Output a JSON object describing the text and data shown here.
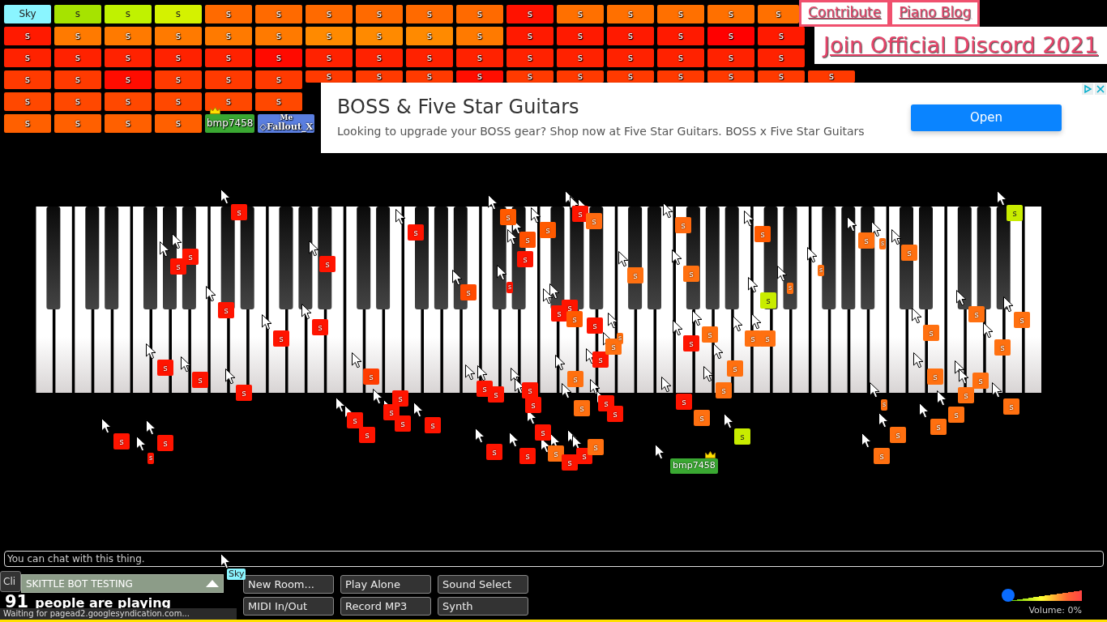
{
  "players": [
    [
      {
        "label": "Sky",
        "color": "#8af5ff",
        "owner": false
      },
      {
        "label": "s",
        "color": "#a6e300",
        "owner": false
      },
      {
        "label": "s",
        "color": "#c0f200",
        "owner": false
      },
      {
        "label": "s",
        "color": "#d4f200",
        "owner": false
      },
      {
        "label": "s",
        "color": "#ff6a00",
        "owner": false
      },
      {
        "label": "s",
        "color": "#ff6a00",
        "owner": false
      },
      {
        "label": "s",
        "color": "#ff6a00",
        "owner": false
      },
      {
        "label": "s",
        "color": "#ff6a00",
        "owner": false
      },
      {
        "label": "s",
        "color": "#ff6a00",
        "owner": false
      },
      {
        "label": "s",
        "color": "#ff6a00",
        "owner": false
      },
      {
        "label": "s",
        "color": "#ff1200",
        "owner": false
      },
      {
        "label": "s",
        "color": "#ff7000",
        "owner": false
      },
      {
        "label": "s",
        "color": "#ff7000",
        "owner": false
      },
      {
        "label": "s",
        "color": "#ff7000",
        "owner": false
      },
      {
        "label": "s",
        "color": "#ff7000",
        "owner": false
      },
      {
        "label": "s",
        "color": "#ff7000",
        "owner": false
      }
    ],
    [
      {
        "label": "s",
        "color": "#ff1a00",
        "owner": false
      },
      {
        "label": "s",
        "color": "#ff7a00",
        "owner": false
      },
      {
        "label": "s",
        "color": "#ff7a00",
        "owner": false
      },
      {
        "label": "s",
        "color": "#ff7a00",
        "owner": false
      },
      {
        "label": "s",
        "color": "#ff7a00",
        "owner": false
      },
      {
        "label": "s",
        "color": "#ff7a00",
        "owner": false
      },
      {
        "label": "s",
        "color": "#ff8a00",
        "owner": false
      },
      {
        "label": "s",
        "color": "#ff8a00",
        "owner": false
      },
      {
        "label": "s",
        "color": "#ff8a00",
        "owner": false
      },
      {
        "label": "s",
        "color": "#ff7a00",
        "owner": false
      },
      {
        "label": "s",
        "color": "#ff1a00",
        "owner": false
      },
      {
        "label": "s",
        "color": "#ff1a00",
        "owner": false
      },
      {
        "label": "s",
        "color": "#ff1a00",
        "owner": false
      },
      {
        "label": "s",
        "color": "#ff1a00",
        "owner": false
      },
      {
        "label": "s",
        "color": "#ff0000",
        "owner": false
      },
      {
        "label": "s",
        "color": "#ff1a00",
        "owner": false
      }
    ],
    [
      {
        "label": "s",
        "color": "#ff2200",
        "owner": false
      },
      {
        "label": "s",
        "color": "#ff2200",
        "owner": false
      },
      {
        "label": "s",
        "color": "#ff2200",
        "owner": false
      },
      {
        "label": "s",
        "color": "#ff2200",
        "owner": false
      },
      {
        "label": "s",
        "color": "#ff2200",
        "owner": false
      },
      {
        "label": "s",
        "color": "#ff0a00",
        "owner": false
      },
      {
        "label": "s",
        "color": "#ff2200",
        "owner": false
      },
      {
        "label": "s",
        "color": "#ff2200",
        "owner": false
      },
      {
        "label": "s",
        "color": "#ff2200",
        "owner": false
      },
      {
        "label": "s",
        "color": "#ff2200",
        "owner": false
      },
      {
        "label": "s",
        "color": "#ff2200",
        "owner": false
      },
      {
        "label": "s",
        "color": "#ff2200",
        "owner": false
      },
      {
        "label": "s",
        "color": "#ff2200",
        "owner": false
      },
      {
        "label": "s",
        "color": "#ff2200",
        "owner": false
      },
      {
        "label": "s",
        "color": "#ff2200",
        "owner": false
      },
      {
        "label": "s",
        "color": "#ff2200",
        "owner": false
      }
    ],
    [
      {
        "label": "s",
        "color": "#ff3a00",
        "owner": false
      },
      {
        "label": "s",
        "color": "#ff3a00",
        "owner": false
      },
      {
        "label": "s",
        "color": "#ff0c00",
        "owner": false
      },
      {
        "label": "s",
        "color": "#ff3a00",
        "owner": false
      },
      {
        "label": "s",
        "color": "#ff3a00",
        "owner": false
      },
      {
        "label": "s",
        "color": "#ff3a00",
        "owner": false
      },
      {
        "label": "s",
        "color": "#ff3a00",
        "owner": false
      },
      {
        "label": "s",
        "color": "#ff3a00",
        "owner": false
      },
      {
        "label": "s",
        "color": "#ff3a00",
        "owner": false
      },
      {
        "label": "s",
        "color": "#ff0e00",
        "owner": false
      },
      {
        "label": "s",
        "color": "#ff3a00",
        "owner": false
      },
      {
        "label": "s",
        "color": "#ff3a00",
        "owner": false
      },
      {
        "label": "s",
        "color": "#ff3a00",
        "owner": false
      },
      {
        "label": "s",
        "color": "#ff3a00",
        "owner": false
      },
      {
        "label": "s",
        "color": "#ff3a00",
        "owner": false
      },
      {
        "label": "s",
        "color": "#ff3a00",
        "owner": false
      },
      {
        "label": "s",
        "color": "#ff3a00",
        "owner": false
      }
    ],
    [
      {
        "label": "s",
        "color": "#ff4800",
        "owner": false
      },
      {
        "label": "s",
        "color": "#ff4800",
        "owner": false
      },
      {
        "label": "s",
        "color": "#ff4800",
        "owner": false
      },
      {
        "label": "s",
        "color": "#ff4800",
        "owner": false
      },
      {
        "label": "s",
        "color": "#ff4800",
        "owner": false
      },
      {
        "label": "s",
        "color": "#ff4800",
        "owner": false
      }
    ],
    [
      {
        "label": "s",
        "color": "#ff6000",
        "owner": false
      },
      {
        "label": "s",
        "color": "#ff6000",
        "owner": false
      },
      {
        "label": "s",
        "color": "#ff6000",
        "owner": false
      },
      {
        "label": "s",
        "color": "#ff6000",
        "owner": false
      },
      {
        "label": "bmp7458",
        "color": "#3aa832",
        "owner": true
      },
      {
        "label": "◇Fallout_X",
        "color": "#5a7ee0",
        "owner": false,
        "note": "Me"
      }
    ]
  ],
  "links": [
    {
      "label": "Contribute"
    },
    {
      "label": "Piano Blog"
    }
  ],
  "discord": "Join Official Discord 2021",
  "ad": {
    "headline": "BOSS & Five Star Guitars",
    "text": "Looking to upgrade your BOSS gear? Shop now at Five Star Guitars. BOSS x Five Star Guitars",
    "button": "Open"
  },
  "cursors": [
    {
      "label": "s",
      "color": "#ff1400",
      "owner": false
    },
    {
      "label": "s",
      "color": "#ff1400",
      "owner": false
    },
    {
      "label": "s",
      "color": "#ff1400",
      "owner": false
    },
    {
      "label": "s",
      "color": "#ff1400",
      "owner": false
    },
    {
      "label": "s",
      "color": "#ff1400",
      "owner": false
    },
    {
      "label": "s",
      "color": "#ff1400",
      "owner": false
    },
    {
      "label": "s",
      "color": "#ff1400",
      "owner": false
    },
    {
      "label": "s",
      "color": "#ff1400",
      "owner": false
    },
    {
      "label": "s",
      "color": "#ff1400",
      "owner": false
    },
    {
      "label": "s",
      "color": "#ff1400",
      "owner": false
    },
    {
      "label": "s",
      "color": "#ff1400",
      "owner": false
    },
    {
      "label": "s",
      "color": "#ff1400",
      "owner": false
    },
    {
      "label": "s",
      "color": "#ff1400",
      "owner": false
    },
    {
      "label": "s",
      "color": "#ff1400",
      "owner": false
    },
    {
      "label": "s",
      "color": "#ff4a00",
      "owner": false
    },
    {
      "label": "s",
      "color": "#ff5a00",
      "owner": false
    },
    {
      "label": "s",
      "color": "#ff5000",
      "owner": false
    },
    {
      "label": "s",
      "color": "#ff1400",
      "owner": false
    },
    {
      "label": "s",
      "color": "#ff5a00",
      "owner": false
    },
    {
      "label": "s",
      "color": "#ff1400",
      "owner": false
    },
    {
      "label": "s",
      "color": "#ff1400",
      "owner": false
    },
    {
      "label": "s",
      "color": "#ff6a10",
      "owner": false
    },
    {
      "label": "s",
      "color": "#ff6a10",
      "owner": false
    },
    {
      "label": "s",
      "color": "#ff5a00",
      "owner": false
    },
    {
      "label": "s",
      "color": "#ff7010",
      "owner": false
    },
    {
      "label": "s",
      "color": "#ff7010",
      "owner": false
    },
    {
      "label": "s",
      "color": "#ff7010",
      "owner": false
    },
    {
      "label": "s",
      "color": "#ff7010",
      "owner": false
    },
    {
      "label": "s",
      "color": "#ff7010",
      "owner": false
    },
    {
      "label": "s",
      "color": "#ff7010",
      "owner": false
    },
    {
      "label": "s",
      "color": "#ff7010",
      "owner": false
    },
    {
      "label": "s",
      "color": "#c8ec00",
      "owner": false
    },
    {
      "label": "s",
      "color": "#c8ec00",
      "owner": false
    },
    {
      "label": "s",
      "color": "#ff1400",
      "owner": false
    },
    {
      "label": "s",
      "color": "#ff1400",
      "owner": false
    },
    {
      "label": "s",
      "color": "#ff5a00",
      "owner": false
    },
    {
      "label": "s",
      "color": "#ff1400",
      "owner": false
    },
    {
      "label": "s",
      "color": "#ff1400",
      "owner": false
    },
    {
      "label": "s",
      "color": "#ff7010",
      "owner": false
    },
    {
      "label": "s",
      "color": "#ff7010",
      "owner": false
    },
    {
      "label": "s",
      "color": "#ff7010",
      "owner": false
    },
    {
      "label": "s",
      "color": "#ff1400",
      "owner": false
    },
    {
      "label": "s",
      "color": "#ff7010",
      "owner": false
    },
    {
      "label": "s",
      "color": "#ff7010",
      "owner": false
    },
    {
      "label": "s",
      "color": "#ff7010",
      "owner": false
    },
    {
      "label": "s",
      "color": "#ff7010",
      "owner": false
    },
    {
      "label": "s",
      "color": "#ff7010",
      "owner": false
    },
    {
      "label": "s",
      "color": "#ff7010",
      "owner": false
    },
    {
      "label": "s",
      "color": "#ff7010",
      "owner": false
    },
    {
      "label": "s",
      "color": "#ff7010",
      "owner": false
    },
    {
      "label": "s",
      "color": "#ff7010",
      "owner": false
    },
    {
      "label": "s",
      "color": "#ff7010",
      "owner": false
    },
    {
      "label": "s",
      "color": "#ff7010",
      "owner": false
    },
    {
      "label": "s",
      "color": "#ff7010",
      "owner": false
    },
    {
      "label": "s",
      "color": "#ff7010",
      "owner": false
    },
    {
      "label": "s",
      "color": "#ff7010",
      "owner": false
    },
    {
      "label": "s",
      "color": "#ff7010",
      "owner": false
    },
    {
      "label": "s",
      "color": "#ff7010",
      "owner": false
    },
    {
      "label": "s",
      "color": "#ff7010",
      "owner": false
    },
    {
      "label": "s",
      "color": "#ff3c00",
      "owner": false
    },
    {
      "label": "s",
      "color": "#ff1400",
      "owner": false
    },
    {
      "label": "s",
      "color": "#ff1400",
      "owner": false
    },
    {
      "label": "s",
      "color": "#ff1400",
      "owner": false
    },
    {
      "label": "s",
      "color": "#ff1400",
      "owner": false
    },
    {
      "label": "s",
      "color": "#ff1400",
      "owner": false
    },
    {
      "label": "s",
      "color": "#ff1400",
      "owner": false
    },
    {
      "label": "s",
      "color": "#ff1400",
      "owner": false
    },
    {
      "label": "s",
      "color": "#ff1400",
      "owner": false
    },
    {
      "label": "s",
      "color": "#ff1400",
      "owner": false
    },
    {
      "label": "s",
      "color": "#ff1400",
      "owner": false
    },
    {
      "label": "s",
      "color": "#ff7010",
      "owner": false
    },
    {
      "label": "s",
      "color": "#ff7010",
      "owner": false
    },
    {
      "label": "s",
      "color": "#ff1400",
      "owner": false
    },
    {
      "label": "s",
      "color": "#ff1400",
      "owner": false
    },
    {
      "label": "s",
      "color": "#ff1400",
      "owner": false
    },
    {
      "label": "s",
      "color": "#ff1400",
      "owner": false
    },
    {
      "label": "s",
      "color": "#ff1400",
      "owner": false
    },
    {
      "label": "s",
      "color": "#ff7010",
      "owner": false
    },
    {
      "label": "s",
      "color": "#ff1400",
      "owner": false
    },
    {
      "label": "s",
      "color": "#ff1400",
      "owner": false
    },
    {
      "label": "s",
      "color": "#ff7010",
      "owner": false
    },
    {
      "label": "s",
      "color": "#ff1400",
      "owner": false
    },
    {
      "label": "s",
      "color": "#ff7010",
      "owner": false
    },
    {
      "label": "s",
      "color": "#c8ec00",
      "owner": false
    },
    {
      "label": "bmp7458",
      "color": "#3aa832",
      "owner": true
    },
    {
      "label": "Sky",
      "color": "#8af5ff",
      "owner": false
    }
  ],
  "chat": {
    "placeholder": "You can chat with this thing."
  },
  "client_button": "Cli",
  "room": {
    "name": "SKITTLE BOT TESTING"
  },
  "count": "91",
  "count_label": "people are playing",
  "buttons": [
    "New Room...",
    "Play Alone",
    "Sound Select",
    "MIDI In/Out",
    "Record MP3",
    "Synth"
  ],
  "volume": {
    "level": 0,
    "label": "Volume: 0%"
  },
  "status": "Waiting for pagead2.googlesyndication.com..."
}
